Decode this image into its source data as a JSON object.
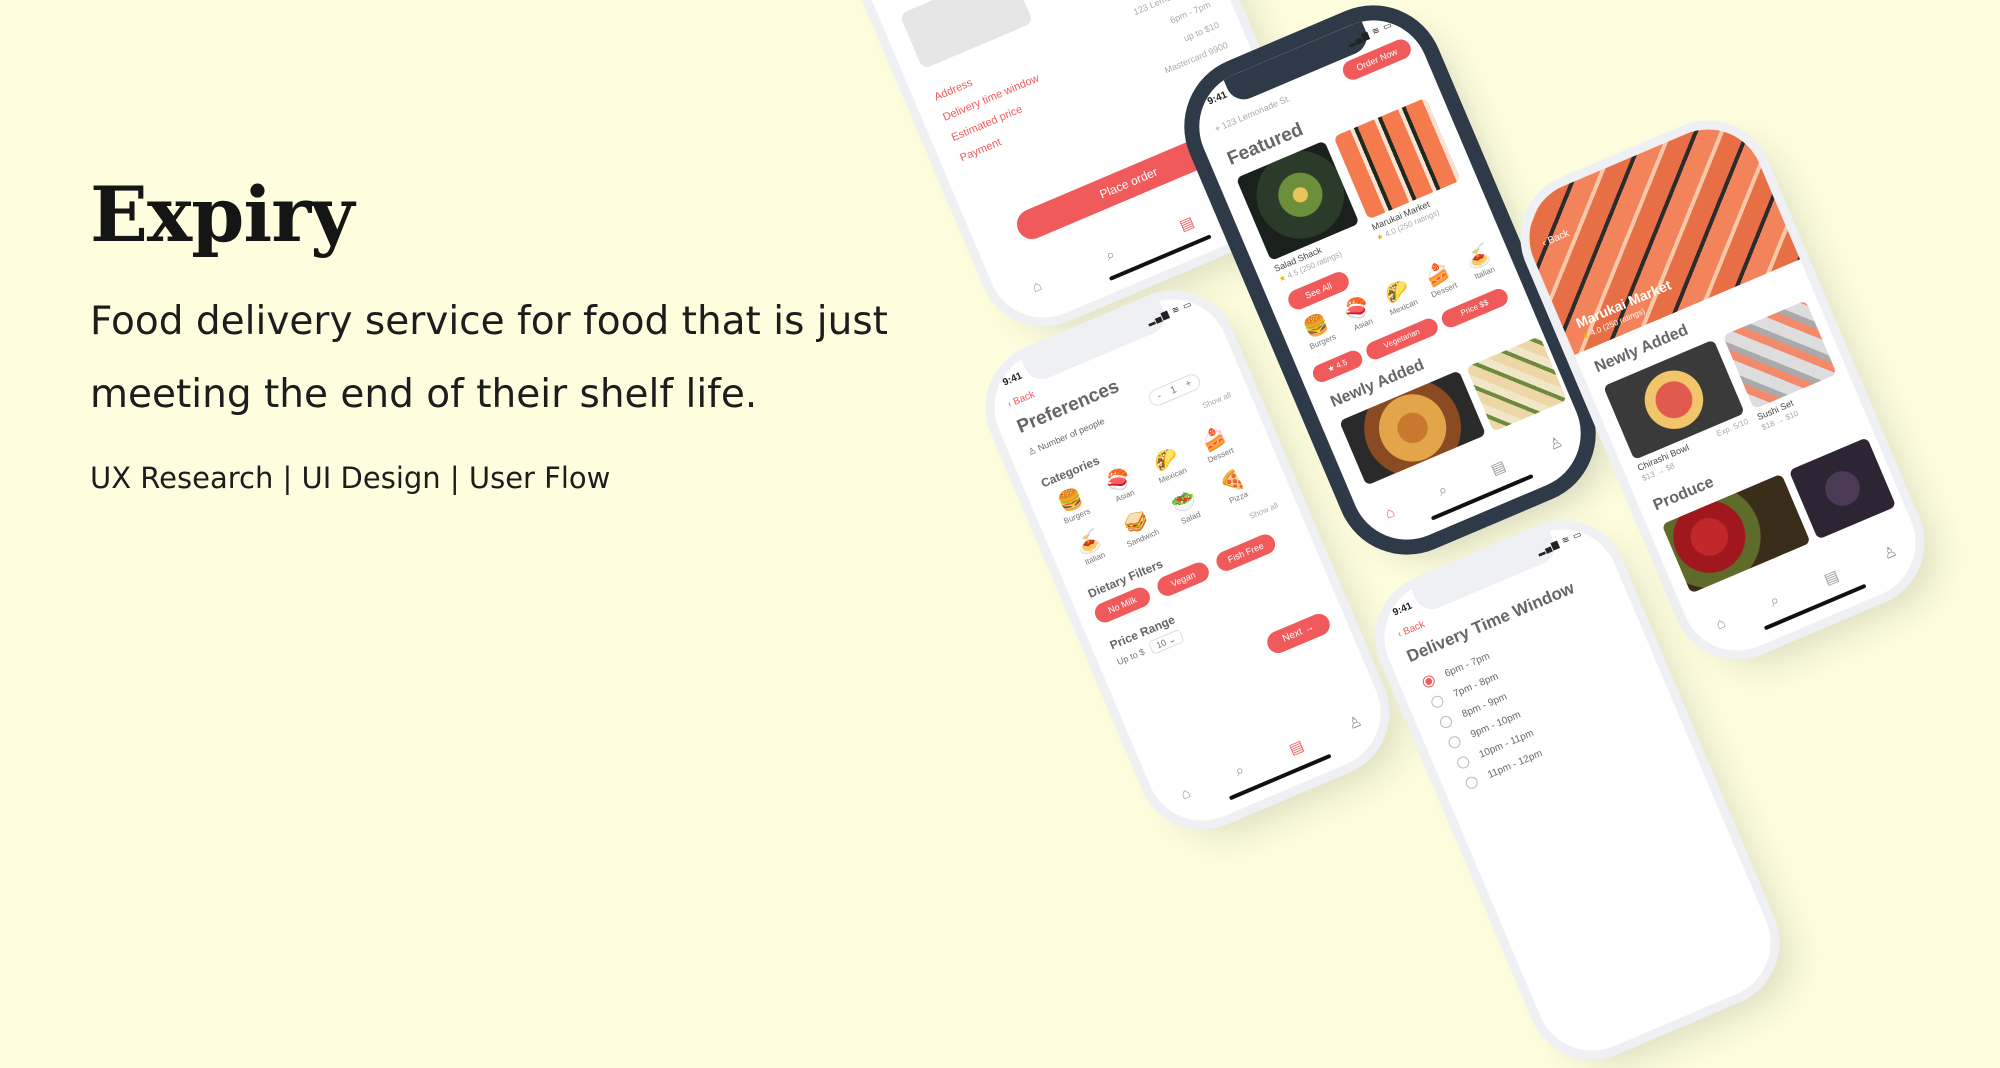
{
  "hero": {
    "title": "Expiry",
    "description": "Food delivery service for food that is just meeting the end of their shelf life.",
    "tags": "UX Research | UI Design | User Flow"
  },
  "colors": {
    "background": "#fefedf",
    "accent": "#f05a5a",
    "frame_dark": "#2f3a48"
  },
  "status": {
    "time": "9:41",
    "signal": "▂▄▆ ≋ ▭"
  },
  "checkout": {
    "rows": [
      {
        "label": "Address",
        "value": "123 Lemonade St."
      },
      {
        "label": "Delivery time window",
        "value": "6pm - 7pm"
      },
      {
        "label": "Estimated price",
        "value": "up to $10"
      },
      {
        "label": "Payment",
        "value": "Mastercard 9900"
      }
    ],
    "cta": "Place order"
  },
  "featured": {
    "address": "123 Lemonade St.",
    "order_btn": "Order Now",
    "heading": "Featured",
    "card1": {
      "name": "Salad Shack",
      "rating": "4.5",
      "reviews": "(250 ratings)"
    },
    "card2": {
      "name": "Marukai Market",
      "rating": "4.0",
      "reviews": "(250 ratings)"
    },
    "see_all": "See All",
    "categories": [
      {
        "icon": "🍔",
        "label": "Burgers"
      },
      {
        "icon": "🍣",
        "label": "Asian"
      },
      {
        "icon": "🌮",
        "label": "Mexican"
      },
      {
        "icon": "🍰",
        "label": "Dessert"
      },
      {
        "icon": "🍝",
        "label": "Italian"
      }
    ],
    "filters": {
      "rating": "★ 4.5",
      "diet": "Vegetarian",
      "price": "Price $$"
    },
    "newly_added": "Newly Added"
  },
  "store": {
    "back": "Back",
    "name": "Marukai Market",
    "rating": "4.0",
    "reviews": "(250 ratings)",
    "newly_added": "Newly Added",
    "items": [
      {
        "name": "Chirashi Bowl",
        "price": "$13 → $8",
        "exp": "Exp. 5/10"
      },
      {
        "name": "Sushi Set",
        "price": "$18 → $10",
        "exp": ""
      }
    ],
    "produce": "Produce"
  },
  "prefs": {
    "back": "Back",
    "heading": "Preferences",
    "people_label": "Number of people",
    "people_value": "1",
    "stepper_minus": "-",
    "stepper_plus": "+",
    "show_all": "Show all",
    "categories_heading": "Categories",
    "categories": [
      {
        "icon": "🍔",
        "label": "Burgers"
      },
      {
        "icon": "🍣",
        "label": "Asian"
      },
      {
        "icon": "🌮",
        "label": "Mexican"
      },
      {
        "icon": "🍰",
        "label": "Dessert"
      },
      {
        "icon": "🥗",
        "label": "Salad"
      },
      {
        "icon": "🍕",
        "label": "Pizza"
      },
      {
        "icon": "🍝",
        "label": "Italian"
      },
      {
        "icon": "🥪",
        "label": "Sandwich"
      }
    ],
    "dietary_heading": "Dietary Filters",
    "dietary": [
      "No Milk",
      "Vegan",
      "Fish Free"
    ],
    "price_heading": "Price Range",
    "price_prefix": "Up to $",
    "price_value": "10",
    "next": "Next"
  },
  "delivery": {
    "back": "Back",
    "heading": "Delivery Time Window",
    "options": [
      "6pm - 7pm",
      "7pm - 8pm",
      "8pm - 9pm",
      "9pm - 10pm",
      "10pm - 11pm",
      "11pm - 12pm"
    ],
    "selected": 0
  },
  "tabs": [
    "⌂",
    "⌕",
    "▤",
    "♙"
  ]
}
